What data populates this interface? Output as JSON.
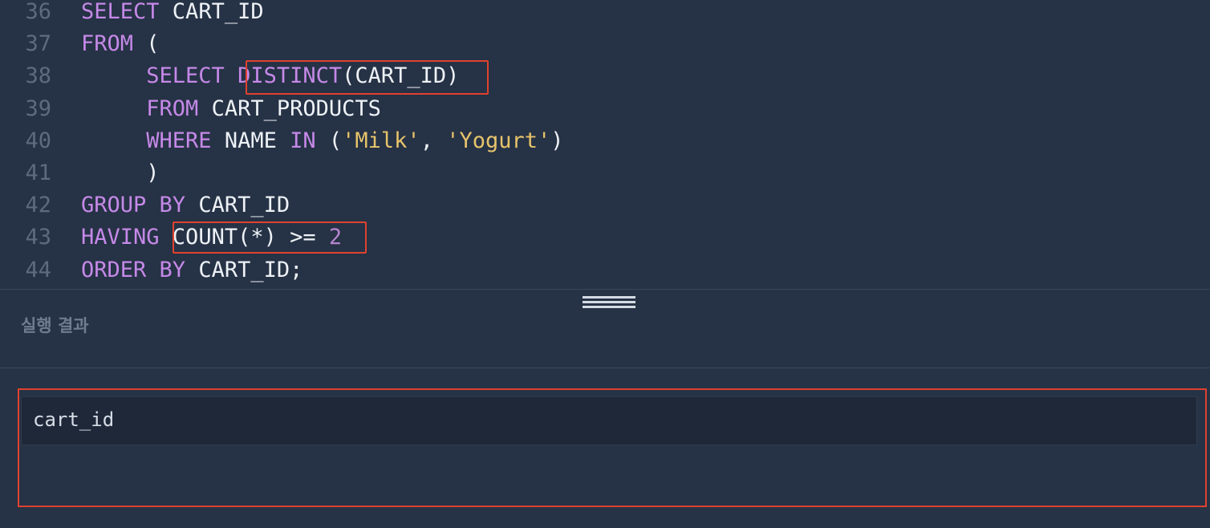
{
  "editor": {
    "lines": [
      {
        "no": "36",
        "tokens": [
          {
            "t": "SELECT",
            "c": "kw"
          },
          {
            "t": " CART_ID",
            "c": "plain"
          }
        ]
      },
      {
        "no": "37",
        "tokens": [
          {
            "t": "FROM",
            "c": "kw"
          },
          {
            "t": " (",
            "c": "plain"
          }
        ]
      },
      {
        "no": "38",
        "tokens": [
          {
            "t": "     ",
            "c": "plain"
          },
          {
            "t": "SELECT",
            "c": "kw"
          },
          {
            "t": " ",
            "c": "plain"
          },
          {
            "t": "DISTINCT",
            "c": "kw"
          },
          {
            "t": "(CART_ID)",
            "c": "plain"
          }
        ]
      },
      {
        "no": "39",
        "tokens": [
          {
            "t": "     ",
            "c": "plain"
          },
          {
            "t": "FROM",
            "c": "kw"
          },
          {
            "t": " CART_PRODUCTS",
            "c": "plain"
          }
        ]
      },
      {
        "no": "40",
        "tokens": [
          {
            "t": "     ",
            "c": "plain"
          },
          {
            "t": "WHERE",
            "c": "kw"
          },
          {
            "t": " NAME ",
            "c": "plain"
          },
          {
            "t": "IN",
            "c": "kw"
          },
          {
            "t": " (",
            "c": "plain"
          },
          {
            "t": "'Milk'",
            "c": "str"
          },
          {
            "t": ", ",
            "c": "plain"
          },
          {
            "t": "'Yogurt'",
            "c": "str"
          },
          {
            "t": ")",
            "c": "plain"
          }
        ]
      },
      {
        "no": "41",
        "tokens": [
          {
            "t": "     )",
            "c": "plain"
          }
        ]
      },
      {
        "no": "42",
        "tokens": [
          {
            "t": "GROUP",
            "c": "kw"
          },
          {
            "t": " ",
            "c": "plain"
          },
          {
            "t": "BY",
            "c": "kw"
          },
          {
            "t": " CART_ID",
            "c": "plain"
          }
        ]
      },
      {
        "no": "43",
        "tokens": [
          {
            "t": "HAVING",
            "c": "kw"
          },
          {
            "t": " COUNT(*) >= ",
            "c": "plain"
          },
          {
            "t": "2",
            "c": "num"
          }
        ]
      },
      {
        "no": "44",
        "tokens": [
          {
            "t": "ORDER",
            "c": "kw"
          },
          {
            "t": " ",
            "c": "plain"
          },
          {
            "t": "BY",
            "c": "kw"
          },
          {
            "t": " CART_ID;",
            "c": "plain"
          }
        ]
      }
    ]
  },
  "results": {
    "title": "실행 결과",
    "columns": [
      "cart_id"
    ],
    "rows": []
  },
  "colors": {
    "background": "#263245",
    "keyword": "#c589e8",
    "string": "#e7c46b",
    "number": "#b784cf",
    "highlight_box": "#e0422f"
  }
}
